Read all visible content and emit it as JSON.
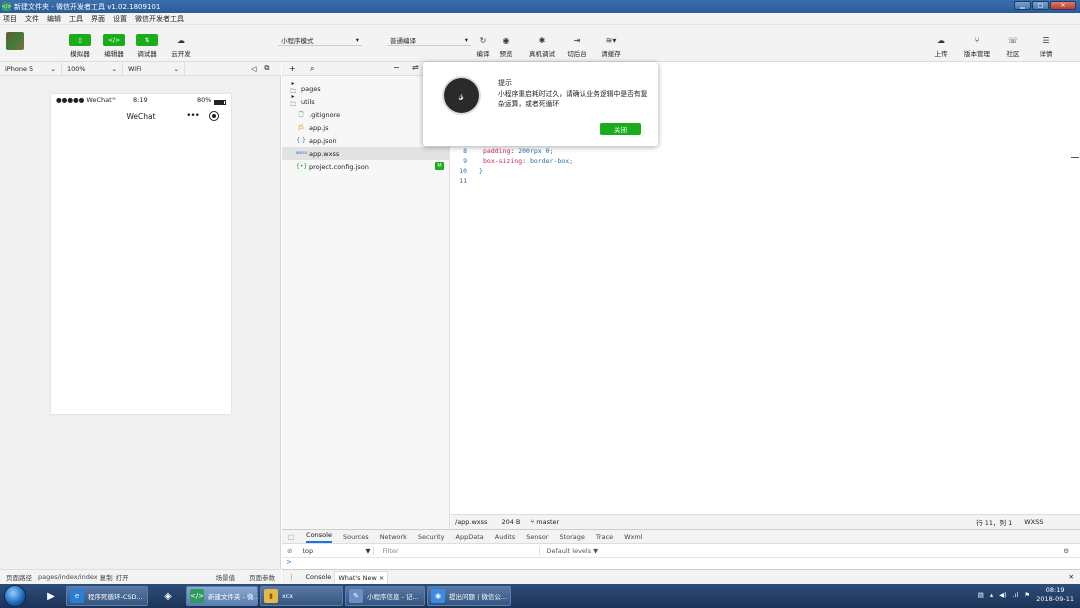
{
  "window": {
    "title": "新建文件夹 - 微信开发者工具 v1.02.1809101",
    "icon": "wechat-devtools-icon"
  },
  "menu": [
    "项目",
    "文件",
    "编辑",
    "工具",
    "界面",
    "设置",
    "微信开发者工具"
  ],
  "toolbar": {
    "simulator": "模拟器",
    "editor": "编辑器",
    "debugger": "调试器",
    "cloud": "云开发",
    "mode": "小程序模式",
    "compile_mode": "普通编译",
    "compile": "编译",
    "preview": "预览",
    "remote_debug": "真机调试",
    "switch_bg": "切后台",
    "clear_cache": "清缓存",
    "upload": "上传",
    "version": "版本管理",
    "community": "社区",
    "details": "详情"
  },
  "device_bar": {
    "device": "iPhone 5",
    "zoom": "100%",
    "network": "WiFi"
  },
  "phone": {
    "carrier": "●●●●● WeChat",
    "time": "8:19",
    "battery": "80%",
    "nav_title": "WeChat",
    "capsule_dots": "•••"
  },
  "sim_footer": {
    "path_label": "页面路径",
    "path": "pages/index/index",
    "copy": "复制",
    "open": "打开",
    "scene": "场景值",
    "params": "页面参数"
  },
  "explorer": {
    "files": [
      {
        "name": "pages",
        "icon": "▸ 🗀"
      },
      {
        "name": "utils",
        "icon": "▸ 🗀"
      },
      {
        "name": ".gitignore",
        "icon": "🗋"
      },
      {
        "name": "app.js",
        "icon": "JS"
      },
      {
        "name": "app.json",
        "icon": "{ }"
      },
      {
        "name": "app.wxss",
        "icon": "wxss"
      },
      {
        "name": "project.config.json",
        "icon": "{•}"
      }
    ],
    "modified_badge": "M"
  },
  "editor": {
    "lines": [
      {
        "n": "8",
        "prop": "padding",
        "val": "200rpx 0;"
      },
      {
        "n": "9",
        "prop": "box-sizing",
        "val": "border-box;"
      },
      {
        "n": "10",
        "text": "}"
      },
      {
        "n": "11",
        "text": ""
      }
    ]
  },
  "editor_status": {
    "file": "/app.wxss",
    "size": "204 B",
    "branch": "master",
    "cursor": "行 11，列 1",
    "lang": "WXSS"
  },
  "console": {
    "tabs": [
      "Console",
      "Sources",
      "Network",
      "Security",
      "AppData",
      "Audits",
      "Sensor",
      "Storage",
      "Trace",
      "Wxml"
    ],
    "context": "top",
    "filter_placeholder": "Filter",
    "levels": "Default levels ▼",
    "prompt": ">",
    "drawer_tabs": [
      "Console",
      "What's New"
    ]
  },
  "modal": {
    "title": "提示",
    "body": "小程序重启耗时过久，请确认业务逻辑中是否有复杂运算，或者死循环",
    "close": "关闭"
  },
  "taskbar": {
    "tasks": [
      {
        "label": "程序死循环-CSD...",
        "icon": "e"
      },
      {
        "label": "新建文件夹 - 微...",
        "icon": "</>"
      },
      {
        "label": "xcx",
        "icon": "▮"
      },
      {
        "label": "小程序信息 - 记...",
        "icon": "✎"
      },
      {
        "label": "提出问题 | 微信公...",
        "icon": "◉"
      }
    ],
    "time": "08:19",
    "date": "2018-09-11"
  }
}
